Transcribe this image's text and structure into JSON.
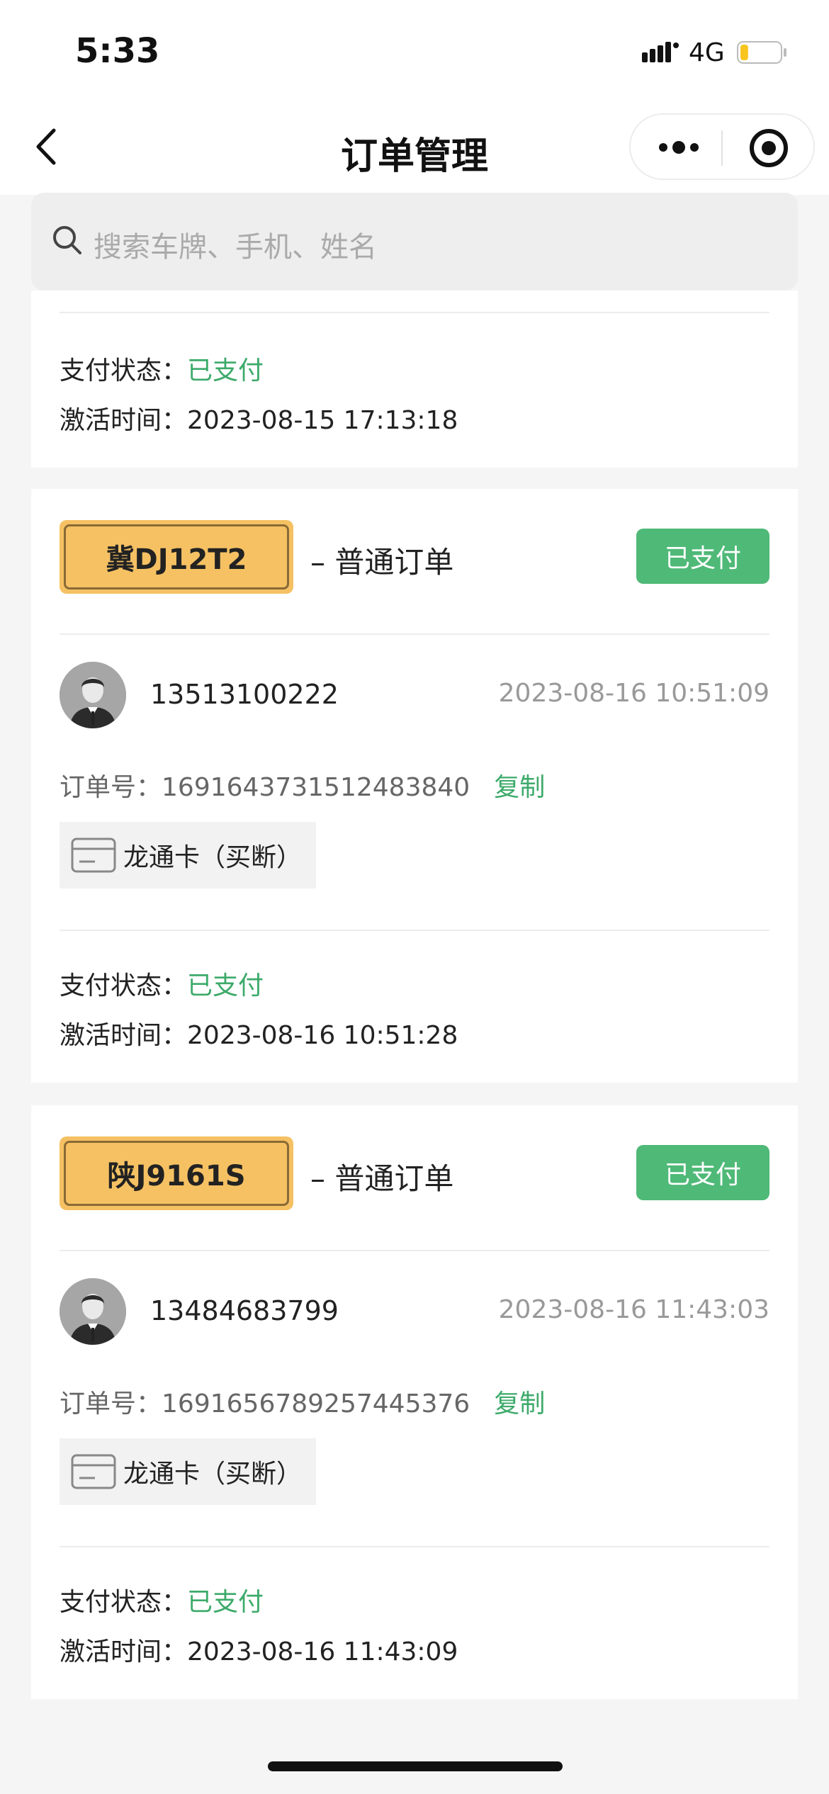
{
  "status_bar": {
    "time": "5:33",
    "network": "4G",
    "battery_level": 0.2
  },
  "nav": {
    "title": "订单管理",
    "back_icon": "chevron-left-icon",
    "more_icon": "more-dots-icon",
    "close_icon": "target-close-icon"
  },
  "search": {
    "placeholder": "搜索车牌、手机、姓名"
  },
  "colors": {
    "accent_green": "#3daa6a",
    "badge_green": "#4fb977",
    "plate_yellow": "#f5c163"
  },
  "partial_order": {
    "pay_status_label": "支付状态：",
    "pay_status_value": "已支付",
    "activation_label": "激活时间：",
    "activation_time": "2023-08-15 17:13:18"
  },
  "orders": [
    {
      "plate": "冀DJ12T2",
      "type": "–  普通订单",
      "badge": "已支付",
      "phone": "13513100222",
      "time": "2023-08-16 10:51:09",
      "order_no_label": "订单号：",
      "order_no": "1691643731512483840",
      "copy_label": "复制",
      "card_name": "龙通卡（买断）",
      "pay_status_label": "支付状态：",
      "pay_status_value": "已支付",
      "activation_label": "激活时间：",
      "activation_time": "2023-08-16 10:51:28"
    },
    {
      "plate": "陕J9161S",
      "type": "–  普通订单",
      "badge": "已支付",
      "phone": "13484683799",
      "time": "2023-08-16 11:43:03",
      "order_no_label": "订单号：",
      "order_no": "1691656789257445376",
      "copy_label": "复制",
      "card_name": "龙通卡（买断）",
      "pay_status_label": "支付状态：",
      "pay_status_value": "已支付",
      "activation_label": "激活时间：",
      "activation_time": "2023-08-16 11:43:09"
    }
  ]
}
